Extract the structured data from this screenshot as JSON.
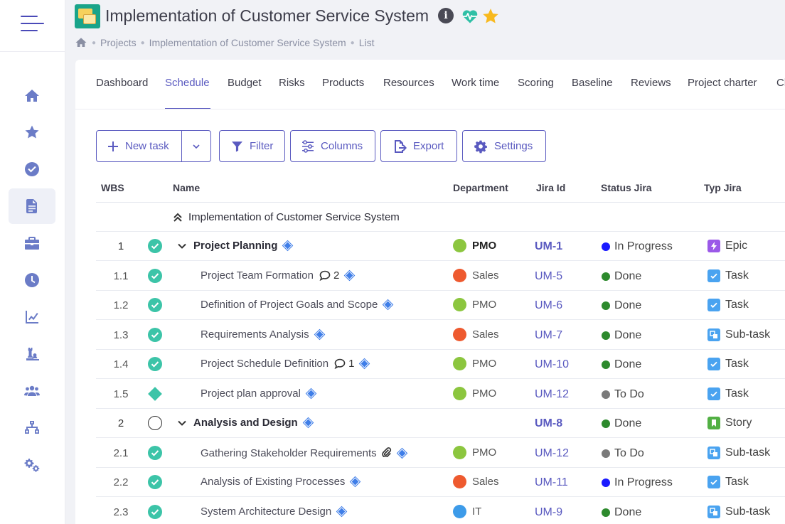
{
  "header": {
    "title": "Implementation of Customer Service System",
    "info_label": "i",
    "breadcrumb": [
      "Projects",
      "Implementation of Customer Service System",
      "List"
    ]
  },
  "sidebar": {
    "items": [
      {
        "icon": "home-icon"
      },
      {
        "icon": "star-icon"
      },
      {
        "icon": "check-circle-icon"
      },
      {
        "icon": "document-icon",
        "active": true
      },
      {
        "icon": "briefcase-icon"
      },
      {
        "icon": "clock-icon"
      },
      {
        "icon": "chart-line-icon"
      },
      {
        "icon": "chess-icon"
      },
      {
        "icon": "users-icon"
      },
      {
        "icon": "org-chart-icon"
      },
      {
        "icon": "cogs-icon"
      }
    ]
  },
  "tabs": [
    "Dashboard",
    "Schedule",
    "Budget",
    "Risks",
    "Products",
    "Resources",
    "Work time",
    "Scoring",
    "Baseline",
    "Reviews",
    "Project charter",
    "Cl"
  ],
  "active_tab": "Schedule",
  "toolbar": {
    "new_task": "New task",
    "filter": "Filter",
    "columns": "Columns",
    "export": "Export",
    "settings": "Settings"
  },
  "table": {
    "headers": {
      "wbs": "WBS",
      "name": "Name",
      "department": "Department",
      "jira_id": "Jira Id",
      "status_jira": "Status Jira",
      "typ_jira": "Typ Jira"
    },
    "group_label": "Implementation of Customer Service System",
    "rows": [
      {
        "wbs": "1",
        "name": "Project Planning",
        "dept": "PMO",
        "jira": "UM-1",
        "status": "In Progress",
        "type": "Epic",
        "parent": true
      },
      {
        "wbs": "1.1",
        "name": "Project Team Formation",
        "comments": "2",
        "dept": "Sales",
        "jira": "UM-5",
        "status": "Done",
        "type": "Task"
      },
      {
        "wbs": "1.2",
        "name": "Definition of Project Goals and Scope",
        "dept": "PMO",
        "jira": "UM-6",
        "status": "Done",
        "type": "Task"
      },
      {
        "wbs": "1.3",
        "name": "Requirements Analysis",
        "dept": "Sales",
        "jira": "UM-7",
        "status": "Done",
        "type": "Sub-task"
      },
      {
        "wbs": "1.4",
        "name": "Project Schedule Definition",
        "comments": "1",
        "dept": "PMO",
        "jira": "UM-10",
        "status": "Done",
        "type": "Task"
      },
      {
        "wbs": "1.5",
        "name": "Project plan approval",
        "dept": "PMO",
        "jira": "UM-12",
        "status": "To Do",
        "type": "Task"
      },
      {
        "wbs": "2",
        "name": "Analysis and Design",
        "dept": "",
        "jira": "UM-8",
        "status": "Done",
        "type": "Story",
        "parent": true
      },
      {
        "wbs": "2.1",
        "name": "Gathering Stakeholder Requirements",
        "dept": "PMO",
        "jira": "UM-12",
        "status": "To Do",
        "type": "Sub-task"
      },
      {
        "wbs": "2.2",
        "name": "Analysis of Existing Processes",
        "dept": "Sales",
        "jira": "UM-11",
        "status": "In Progress",
        "type": "Task"
      },
      {
        "wbs": "2.3",
        "name": "System Architecture Design",
        "dept": "IT",
        "jira": "UM-9",
        "status": "Done",
        "type": "Sub-task"
      }
    ]
  },
  "colors": {
    "accent": "#5a5ac0",
    "pmo": "#8cc63f",
    "sales": "#ee5a2f",
    "it": "#3d9be9",
    "in_progress": "#1a1aff",
    "done": "#2d8a2d",
    "todo": "#7a7a7a",
    "epic": "#9b59e8",
    "task": "#4aa3f0",
    "subtask": "#4aa3f0",
    "story": "#52b044",
    "check": "#3cc4a8"
  }
}
